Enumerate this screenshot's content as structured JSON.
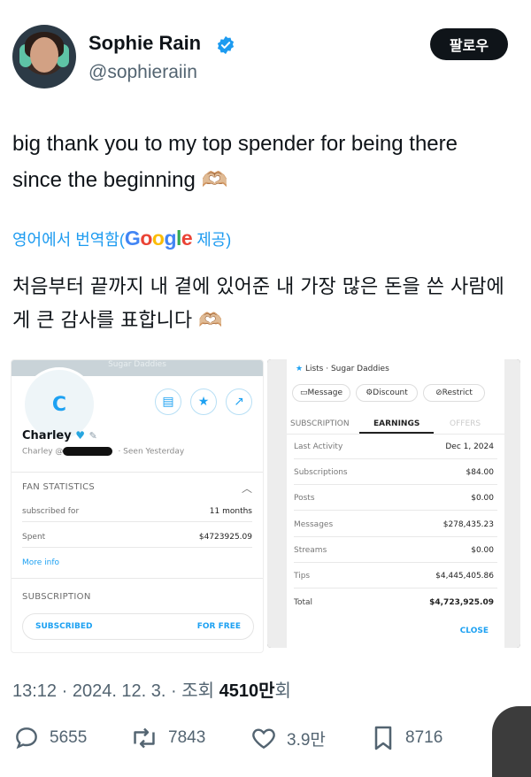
{
  "author": {
    "name": "Sophie Rain",
    "handle": "@sophieraiin",
    "follow_label": "팔로우"
  },
  "tweet": {
    "text": "big thank you to my top spender for being there since the beginning 🫶🏼",
    "translated_prefix": "영어에서 번역함(",
    "translated_brand": "Google",
    "translated_suffix": " 제공)",
    "translation": "처음부터 끝까지 내 곁에 있어준 내 가장 많은 돈을 쓴 사람에게 큰 감사를 표합니다 🫶🏼"
  },
  "left_screenshot": {
    "banner_text": "Sugar Daddies",
    "avatar_letter": "C",
    "name": "Charley",
    "sub_prefix": "Charley @",
    "seen": "· Seen  Yesterday",
    "fan_stats_title": "FAN STATISTICS",
    "rows": [
      {
        "label": "subscribed for",
        "value": "11 months"
      },
      {
        "label": "Spent",
        "value": "$4723925.09"
      }
    ],
    "more_info": "More info",
    "subscription_title": "SUBSCRIPTION",
    "subscribed": "SUBSCRIBED",
    "for_free": "FOR FREE"
  },
  "right_screenshot": {
    "lists": "Lists  ·  Sugar Daddies",
    "buttons": [
      "Message",
      "Discount",
      "Restrict"
    ],
    "tabs": [
      "SUBSCRIPTION",
      "EARNINGS",
      "OFFERS"
    ],
    "rows": [
      {
        "label": "Last Activity",
        "value": "Dec 1, 2024"
      },
      {
        "label": "Subscriptions",
        "value": "$84.00"
      },
      {
        "label": "Posts",
        "value": "$0.00"
      },
      {
        "label": "Messages",
        "value": "$278,435.23"
      },
      {
        "label": "Streams",
        "value": "$0.00"
      },
      {
        "label": "Tips",
        "value": "$4,445,405.86"
      },
      {
        "label": "Total",
        "value": "$4,723,925.09"
      }
    ],
    "close": "CLOSE"
  },
  "meta": {
    "time_date": "13:12 · 2024. 12. 3. · 조회 ",
    "views": "4510만",
    "views_suffix": "회"
  },
  "actions": {
    "replies": "5655",
    "reposts": "7843",
    "likes": "3.9만",
    "bookmarks": "8716"
  },
  "colors": {
    "accent": "#1d9bf0",
    "verified": "#1d9bf0",
    "muted": "#536471"
  }
}
